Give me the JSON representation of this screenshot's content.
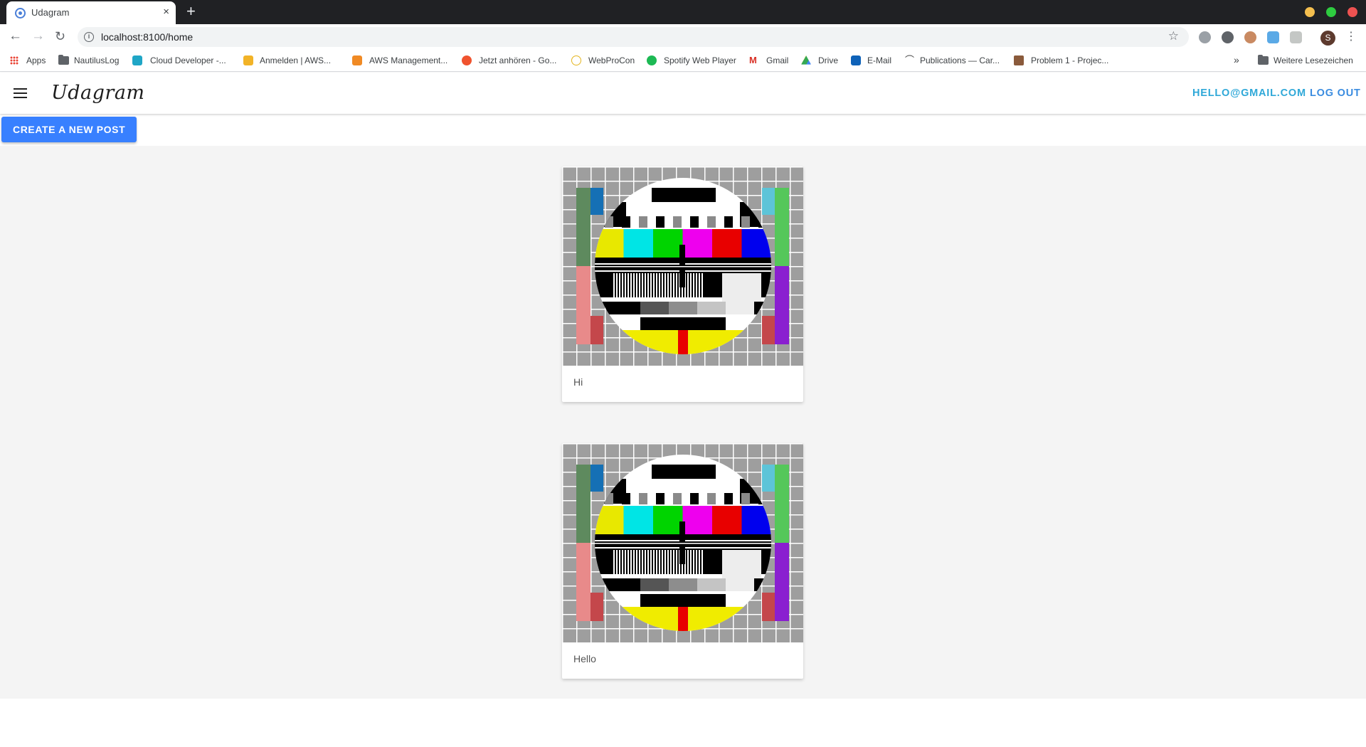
{
  "browser": {
    "tab_title": "Udagram",
    "tab_close": "×",
    "new_tab": "+",
    "url": "localhost:8100/home",
    "bookmarks": [
      {
        "label": "Apps"
      },
      {
        "label": "NautilusLog"
      },
      {
        "label": "Cloud Developer -..."
      },
      {
        "label": "Anmelden | AWS..."
      },
      {
        "label": "AWS Management..."
      },
      {
        "label": "Jetzt anhören - Go..."
      },
      {
        "label": "WebProCon"
      },
      {
        "label": "Spotify Web Player"
      },
      {
        "label": "Gmail"
      },
      {
        "label": "Drive"
      },
      {
        "label": "E-Mail"
      },
      {
        "label": "Publications — Car..."
      },
      {
        "label": "Problem 1 - Projec..."
      }
    ],
    "more_bookmarks": "»",
    "other_bookmarks": "Weitere Lesezeichen",
    "profile_initial": "S"
  },
  "app": {
    "title": "Udagram",
    "user_email": "HELLO@GMAIL.COM",
    "logout_label": "LOG OUT",
    "create_post_label": "CREATE A NEW POST"
  },
  "posts": [
    {
      "caption": "Hi"
    },
    {
      "caption": "Hello"
    }
  ],
  "colors": {
    "primary": "#3880ff",
    "header_link": "#2fa8d8"
  }
}
